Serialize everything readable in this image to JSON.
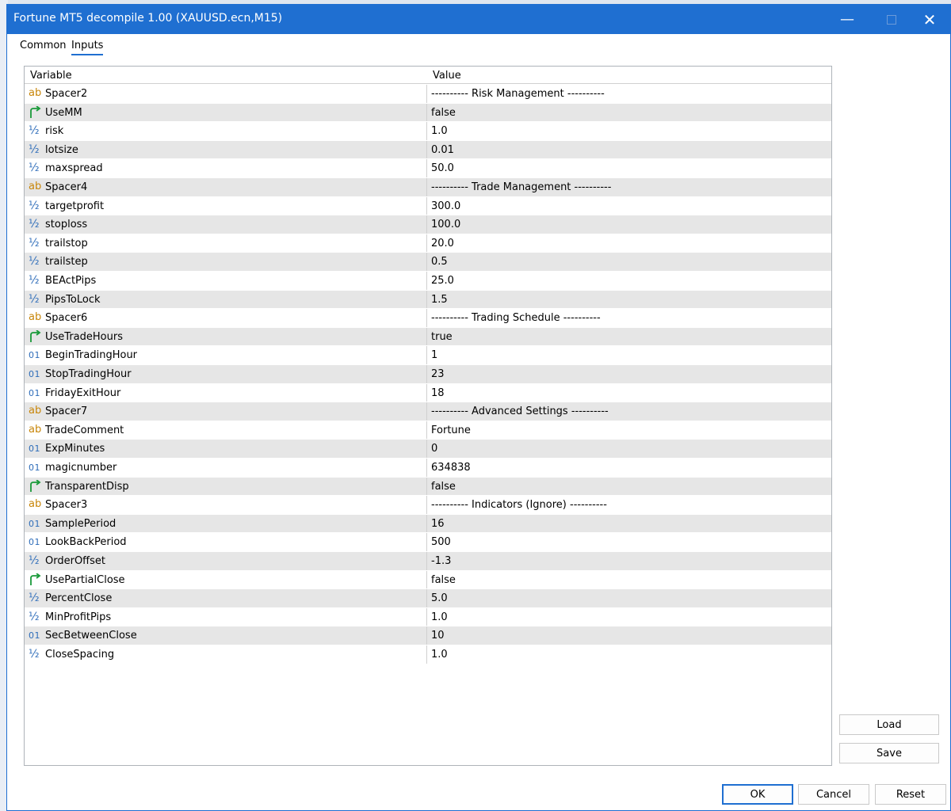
{
  "window": {
    "title": "Fortune MT5 decompile 1.00 (XAUUSD.ecn,M15)",
    "minimize_glyph": "—",
    "close_glyph": "✕"
  },
  "tabs": [
    {
      "label": "Common",
      "active": false
    },
    {
      "label": "Inputs",
      "active": true
    }
  ],
  "grid": {
    "col_variable": "Variable",
    "col_value": "Value",
    "rows": [
      {
        "type": "string",
        "icon": "ab",
        "name": "Spacer2",
        "value": "---------- Risk Management ----------"
      },
      {
        "type": "bool",
        "icon": "bool-arrow",
        "name": "UseMM",
        "value": "false"
      },
      {
        "type": "double",
        "icon": "½",
        "name": "risk",
        "value": "1.0"
      },
      {
        "type": "double",
        "icon": "½",
        "name": "lotsize",
        "value": "0.01"
      },
      {
        "type": "double",
        "icon": "½",
        "name": "maxspread",
        "value": "50.0"
      },
      {
        "type": "string",
        "icon": "ab",
        "name": "Spacer4",
        "value": "---------- Trade Management ----------"
      },
      {
        "type": "double",
        "icon": "½",
        "name": "targetprofit",
        "value": "300.0"
      },
      {
        "type": "double",
        "icon": "½",
        "name": "stoploss",
        "value": "100.0"
      },
      {
        "type": "double",
        "icon": "½",
        "name": "trailstop",
        "value": "20.0"
      },
      {
        "type": "double",
        "icon": "½",
        "name": "trailstep",
        "value": "0.5"
      },
      {
        "type": "double",
        "icon": "½",
        "name": "BEActPips",
        "value": "25.0"
      },
      {
        "type": "double",
        "icon": "½",
        "name": "PipsToLock",
        "value": "1.5"
      },
      {
        "type": "string",
        "icon": "ab",
        "name": "Spacer6",
        "value": "---------- Trading Schedule ----------"
      },
      {
        "type": "bool",
        "icon": "bool-arrow",
        "name": "UseTradeHours",
        "value": "true"
      },
      {
        "type": "int",
        "icon": "01",
        "name": "BeginTradingHour",
        "value": "1"
      },
      {
        "type": "int",
        "icon": "01",
        "name": "StopTradingHour",
        "value": "23"
      },
      {
        "type": "int",
        "icon": "01",
        "name": "FridayExitHour",
        "value": "18"
      },
      {
        "type": "string",
        "icon": "ab",
        "name": "Spacer7",
        "value": "---------- Advanced Settings ----------"
      },
      {
        "type": "string",
        "icon": "ab",
        "name": "TradeComment",
        "value": "Fortune"
      },
      {
        "type": "int",
        "icon": "01",
        "name": "ExpMinutes",
        "value": "0"
      },
      {
        "type": "int",
        "icon": "01",
        "name": "magicnumber",
        "value": "634838"
      },
      {
        "type": "bool",
        "icon": "bool-arrow",
        "name": "TransparentDisp",
        "value": "false"
      },
      {
        "type": "string",
        "icon": "ab",
        "name": "Spacer3",
        "value": "---------- Indicators (Ignore) ----------"
      },
      {
        "type": "int",
        "icon": "01",
        "name": "SamplePeriod",
        "value": "16"
      },
      {
        "type": "int",
        "icon": "01",
        "name": "LookBackPeriod",
        "value": "500"
      },
      {
        "type": "double",
        "icon": "½",
        "name": "OrderOffset",
        "value": "-1.3"
      },
      {
        "type": "bool",
        "icon": "bool-arrow",
        "name": "UsePartialClose",
        "value": "false"
      },
      {
        "type": "double",
        "icon": "½",
        "name": "PercentClose",
        "value": "5.0"
      },
      {
        "type": "double",
        "icon": "½",
        "name": "MinProfitPips",
        "value": "1.0"
      },
      {
        "type": "int",
        "icon": "01",
        "name": "SecBetweenClose",
        "value": "10"
      },
      {
        "type": "double",
        "icon": "½",
        "name": "CloseSpacing",
        "value": "1.0"
      }
    ]
  },
  "side_buttons": {
    "load": "Load",
    "save": "Save"
  },
  "footer_buttons": {
    "ok": "OK",
    "cancel": "Cancel",
    "reset": "Reset"
  },
  "colors": {
    "titlebar": "#1f6fd1",
    "row_alt": "#e6e6e6",
    "icon_string": "#c8860a",
    "icon_numeric": "#2d6cb9",
    "icon_bool": "#1a9a3a"
  }
}
